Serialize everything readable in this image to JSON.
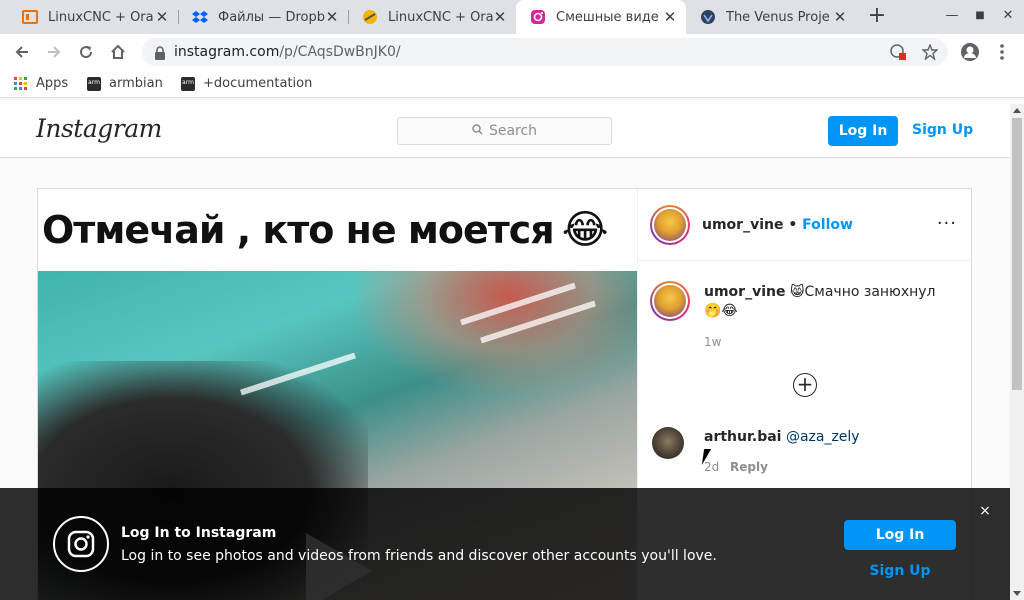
{
  "browser": {
    "tabs": [
      {
        "title": "LinuxCNC + Ora",
        "icon": "orange-box-icon"
      },
      {
        "title": "Файлы — Dropb",
        "icon": "dropbox-icon"
      },
      {
        "title": "LinuxCNC + Ora",
        "icon": "linuxcnc-icon"
      },
      {
        "title": "Смешные виде",
        "icon": "instagram-icon",
        "active": true
      },
      {
        "title": "The Venus Proje",
        "icon": "venus-icon"
      }
    ],
    "new_tab": "+",
    "url_host": "instagram.com",
    "url_path": "/p/CAqsDwBnJK0/",
    "bookmarks": [
      {
        "label": "Apps"
      },
      {
        "label": "armbian"
      },
      {
        "label": "+documentation"
      }
    ]
  },
  "instagram": {
    "logo": "Instagram",
    "search_placeholder": "Search",
    "login_label": "Log In",
    "signup_label": "Sign Up"
  },
  "post": {
    "media_caption": "Отмечай , кто не моется",
    "media_emoji": "😂",
    "author": "umor_vine",
    "separator": " • ",
    "follow_label": "Follow",
    "more_label": "···",
    "caption_author": "umor_vine",
    "caption_text": "😸Смачно занюхнул 🤭😂",
    "caption_time": "1w",
    "load_more": "+",
    "comments": [
      {
        "user": "arthur.bai",
        "text": "@aza_zely",
        "time": "2d",
        "reply_label": "Reply"
      }
    ]
  },
  "banner": {
    "title": "Log In to Instagram",
    "subtitle": "Log in to see photos and videos from friends and discover other accounts you'll love.",
    "login_label": "Log In",
    "signup_label": "Sign Up",
    "close": "×"
  },
  "colors": {
    "accent": "#0095f6",
    "tabstrip": "#dee1e6",
    "banner_bg": "#000000"
  }
}
